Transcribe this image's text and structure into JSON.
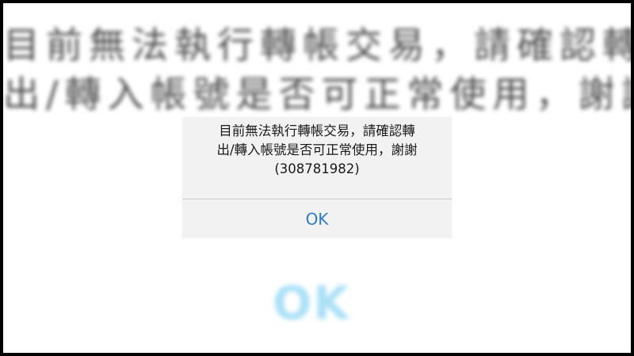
{
  "background": {
    "message_lines": [
      "目前無法執行轉帳交易，請確認轉",
      "出/轉入帳號是否可正常使用，謝謝"
    ],
    "ok_label": "OK"
  },
  "alert": {
    "message_lines": [
      "目前無法執行轉帳交易，請確認轉",
      "出/轉入帳號是否可正常使用，謝謝",
      "(308781982)"
    ],
    "ok_label": "OK"
  },
  "colors": {
    "accent": "#2f79c9",
    "alert_background": "#f2f2f2",
    "divider": "#c8c8cc"
  }
}
